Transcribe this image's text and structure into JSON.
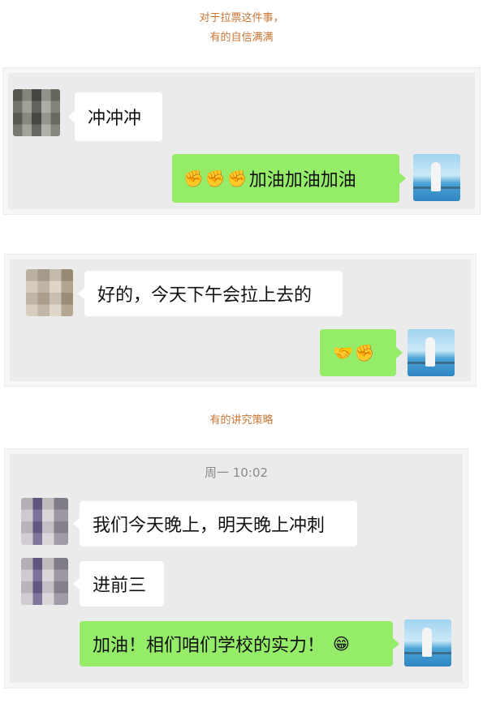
{
  "captions": {
    "top_line1": "对于拉票这件事，",
    "top_line2": "有的自信满满",
    "middle": "有的讲究策略"
  },
  "chat1": {
    "received_text": "冲冲冲",
    "sent_emojis": [
      "✊",
      "✊",
      "✊"
    ],
    "sent_text": "加油加油加油"
  },
  "chat2": {
    "received_text": "好的，今天下午会拉上去的",
    "sent_emojis": [
      "🤝",
      "✊"
    ]
  },
  "chat3": {
    "timestamp": "周一 10:02",
    "received_1": "我们今天晚上，明天晚上冲刺",
    "received_2": "进前三",
    "sent_text": "加油！相们咱们学校的实力！",
    "sent_emoji": "😁"
  },
  "colors": {
    "caption": "#c87533",
    "sent_bubble": "#95ec69",
    "received_bubble": "#ffffff",
    "chat_bg": "#ebebeb"
  }
}
